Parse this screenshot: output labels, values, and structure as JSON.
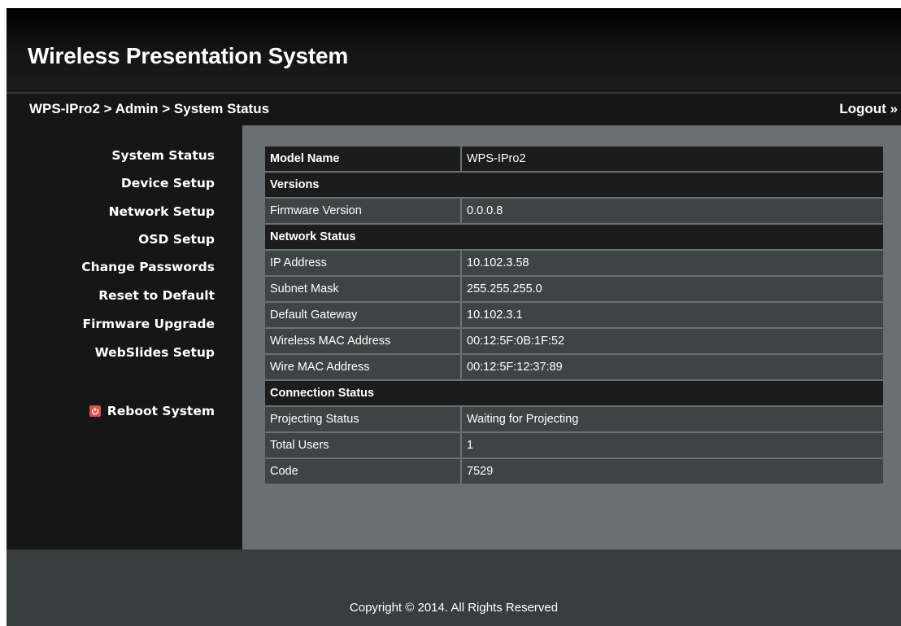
{
  "header": {
    "title": "Wireless Presentation System"
  },
  "breadcrumb": {
    "path": "WPS-IPro2 > Admin > System Status",
    "logout_label": "Logout »"
  },
  "sidebar": {
    "items": [
      {
        "label": "System Status"
      },
      {
        "label": "Device Setup"
      },
      {
        "label": "Network Setup"
      },
      {
        "label": "OSD Setup"
      },
      {
        "label": "Change Passwords"
      },
      {
        "label": "Reset to Default"
      },
      {
        "label": "Firmware Upgrade"
      },
      {
        "label": "WebSlides Setup"
      }
    ],
    "reboot_label": "Reboot System",
    "reboot_icon": "power-icon"
  },
  "status": {
    "model_name_label": "Model Name",
    "model_name_value": "WPS-IPro2",
    "versions_section": "Versions",
    "firmware_label": "Firmware Version",
    "firmware_value": "0.0.0.8",
    "network_section": "Network Status",
    "ip_label": "IP Address",
    "ip_value": "10.102.3.58",
    "subnet_label": "Subnet Mask",
    "subnet_value": "255.255.255.0",
    "gateway_label": "Default Gateway",
    "gateway_value": "10.102.3.1",
    "wireless_mac_label": "Wireless MAC Address",
    "wireless_mac_value": "00:12:5F:0B:1F:52",
    "wire_mac_label": "Wire MAC Address",
    "wire_mac_value": "00:12:5F:12:37:89",
    "connection_section": "Connection Status",
    "projecting_label": "Projecting Status",
    "projecting_value": "Waiting for Projecting",
    "users_label": "Total Users",
    "users_value": "1",
    "code_label": "Code",
    "code_value": "7529"
  },
  "footer": {
    "copyright": "Copyright © 2014. All Rights Reserved"
  },
  "colors": {
    "header_bg": "#000000",
    "sidebar_bg": "#161616",
    "content_bg": "#6a7071",
    "cell_bg": "#3f4344",
    "section_bg": "#1c1c1c",
    "footer_bg": "#3a3d3e",
    "reboot_icon": "#d9534f"
  }
}
